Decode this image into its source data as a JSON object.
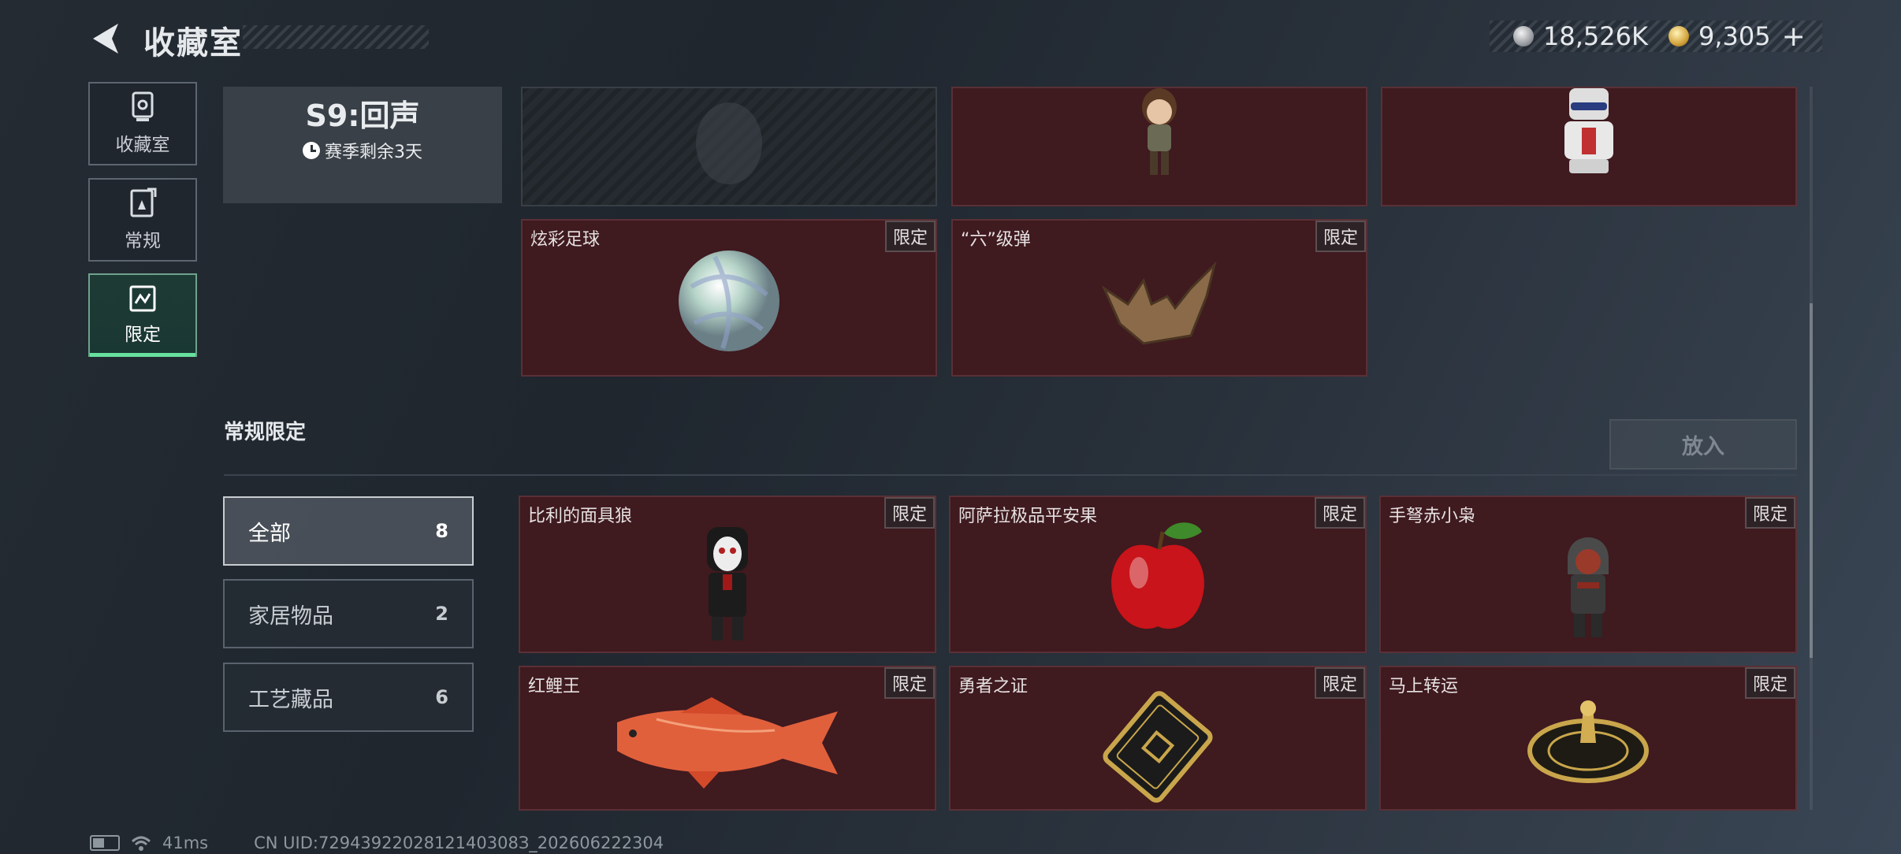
{
  "header": {
    "title": "收藏室",
    "back_icon": "back-arrow-icon"
  },
  "currency": {
    "silver": "18,526K",
    "gold": "9,305",
    "add": "+"
  },
  "nav": [
    {
      "label": "收藏室",
      "icon": "display-case-icon",
      "active": false
    },
    {
      "label": "常规",
      "icon": "collection-card-icon",
      "active": false
    },
    {
      "label": "限定",
      "icon": "limited-map-icon",
      "active": true
    }
  ],
  "season": {
    "name": "S9:回声",
    "remaining": "赛季剩余3天"
  },
  "top_items": [
    {
      "name": "",
      "badge": "",
      "icon": "locked-figure-icon",
      "empty": true
    },
    {
      "name": "",
      "badge": "",
      "icon": "explorer-girl-figure-icon"
    },
    {
      "name": "",
      "badge": "",
      "icon": "robot-figure-icon"
    },
    {
      "name": "炫彩足球",
      "badge": "限定",
      "icon": "iridescent-ball-icon"
    },
    {
      "name": "“六”级弹",
      "badge": "限定",
      "icon": "bullet-hand-sculpture-icon"
    }
  ],
  "section": {
    "title": "常规限定",
    "put_button": "放入"
  },
  "filters": [
    {
      "label": "全部",
      "count": "8"
    },
    {
      "label": "家居物品",
      "count": "2"
    },
    {
      "label": "工艺藏品",
      "count": "6"
    }
  ],
  "items": [
    {
      "name": "比利的面具狼",
      "badge": "限定",
      "icon": "puppet-doll-icon"
    },
    {
      "name": "阿萨拉极品平安果",
      "badge": "限定",
      "icon": "red-apple-icon"
    },
    {
      "name": "手弩赤小枭",
      "badge": "限定",
      "icon": "hooded-figure-icon"
    },
    {
      "name": "红鲤王",
      "badge": "限定",
      "icon": "red-carp-icon"
    },
    {
      "name": "勇者之证",
      "badge": "限定",
      "icon": "gold-card-icon"
    },
    {
      "name": "马上转运",
      "badge": "限定",
      "icon": "fortune-wheel-icon"
    }
  ],
  "status": {
    "ping": "41ms",
    "uid": "CN UID:7294392202812140308З_202606222304"
  }
}
